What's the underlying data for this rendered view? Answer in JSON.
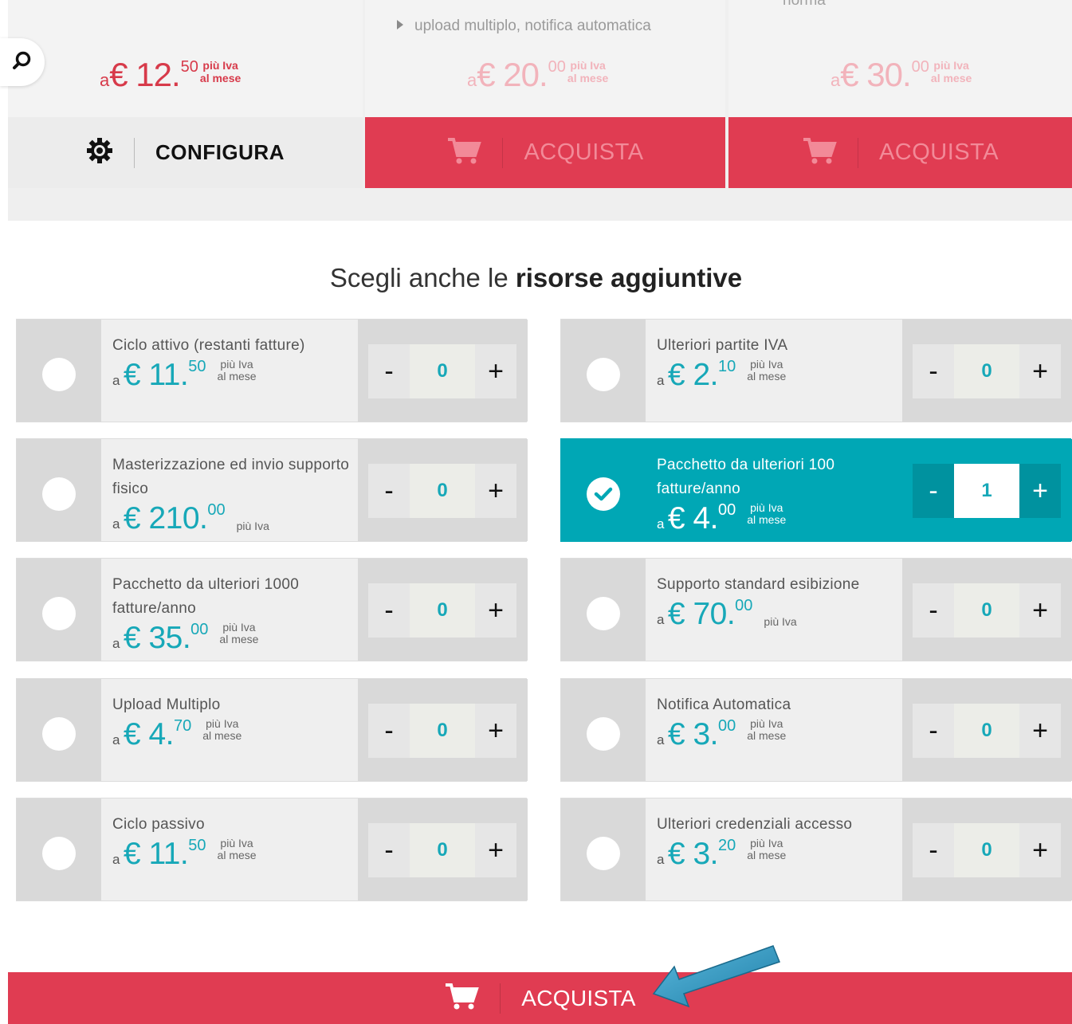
{
  "plans": [
    {
      "feature": "",
      "cut_text": "",
      "price_prefix": "a",
      "price_main": "€ 12.",
      "price_cents": "50",
      "tax_line1": "più Iva",
      "tax_line2": "al mese",
      "action_label": "CONFIGURA",
      "action_icon": "gear-icon"
    },
    {
      "feature": "upload multiplo, notifica automatica",
      "cut_text": "",
      "price_prefix": "a",
      "price_main": "€ 20.",
      "price_cents": "00",
      "tax_line1": "più Iva",
      "tax_line2": "al mese",
      "action_label": "ACQUISTA",
      "action_icon": "cart-icon"
    },
    {
      "feature": "",
      "cut_text": "norma",
      "price_prefix": "a",
      "price_main": "€ 30.",
      "price_cents": "00",
      "tax_line1": "più Iva",
      "tax_line2": "al mese",
      "action_label": "ACQUISTA",
      "action_icon": "cart-icon"
    }
  ],
  "section": {
    "title_light": "Scegli anche le ",
    "title_bold": "risorse aggiuntive"
  },
  "addons": [
    {
      "name": "Ciclo attivo (restanti fatture)",
      "prefix": "a",
      "price_main": "€ 11.",
      "price_cents": "50",
      "tax_line1": "più Iva",
      "tax_line2": "al mese",
      "qty": "0",
      "selected": false
    },
    {
      "name": "Ulteriori partite IVA",
      "prefix": "a",
      "price_main": "€ 2.",
      "price_cents": "10",
      "tax_line1": "più Iva",
      "tax_line2": "al mese",
      "qty": "0",
      "selected": false
    },
    {
      "name": "Masterizzazione ed invio supporto fisico",
      "prefix": "a",
      "price_main": "€ 210.",
      "price_cents": "00",
      "tax_line1": "più Iva",
      "tax_line2": "",
      "qty": "0",
      "selected": false
    },
    {
      "name": "Pacchetto da ulteriori 100 fatture/anno",
      "prefix": "a",
      "price_main": "€ 4.",
      "price_cents": "00",
      "tax_line1": "più Iva",
      "tax_line2": "al mese",
      "qty": "1",
      "selected": true
    },
    {
      "name": "Pacchetto da ulteriori 1000 fatture/anno",
      "prefix": "a",
      "price_main": "€ 35.",
      "price_cents": "00",
      "tax_line1": "più Iva",
      "tax_line2": "al mese",
      "qty": "0",
      "selected": false
    },
    {
      "name": "Supporto standard esibizione",
      "prefix": "a",
      "price_main": "€ 70.",
      "price_cents": "00",
      "tax_line1": "più Iva",
      "tax_line2": "",
      "qty": "0",
      "selected": false
    },
    {
      "name": "Upload Multiplo",
      "prefix": "a",
      "price_main": "€ 4.",
      "price_cents": "70",
      "tax_line1": "più Iva",
      "tax_line2": "al mese",
      "qty": "0",
      "selected": false
    },
    {
      "name": "Notifica Automatica",
      "prefix": "a",
      "price_main": "€ 3.",
      "price_cents": "00",
      "tax_line1": "più Iva",
      "tax_line2": "al mese",
      "qty": "0",
      "selected": false
    },
    {
      "name": "Ciclo passivo",
      "prefix": "a",
      "price_main": "€ 11.",
      "price_cents": "50",
      "tax_line1": "più Iva",
      "tax_line2": "al mese",
      "qty": "0",
      "selected": false
    },
    {
      "name": "Ulteriori credenziali accesso",
      "prefix": "a",
      "price_main": "€ 3.",
      "price_cents": "20",
      "tax_line1": "più Iva",
      "tax_line2": "al mese",
      "qty": "0",
      "selected": false
    }
  ],
  "stepper": {
    "minus": "-",
    "plus": "+"
  },
  "bottom": {
    "label": "ACQUISTA",
    "icon": "cart-icon"
  },
  "colors": {
    "accent_red": "#e03c52",
    "accent_teal": "#00a7b5",
    "price_teal": "#17a8b8"
  }
}
